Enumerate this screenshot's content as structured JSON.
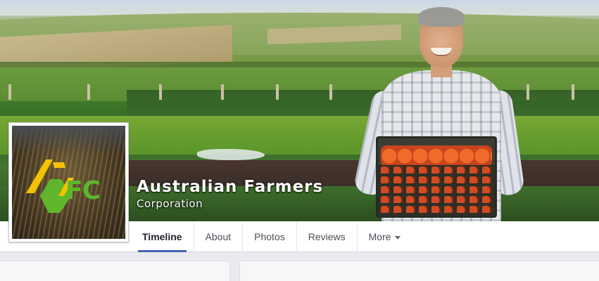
{
  "page": {
    "name": "Australian Farmers",
    "subtitle": "Corporation"
  },
  "profile": {
    "logo_text": "FC",
    "logo_colors": {
      "yellow": "#f3c300",
      "green": "#5fb62a"
    }
  },
  "tabs": [
    {
      "label": "Timeline",
      "active": true
    },
    {
      "label": "About",
      "active": false
    },
    {
      "label": "Photos",
      "active": false
    },
    {
      "label": "Reviews",
      "active": false
    },
    {
      "label": "More",
      "active": false,
      "has_caret": true
    }
  ],
  "colors": {
    "accent": "#4267b2",
    "page_background": "#e9ebee"
  }
}
